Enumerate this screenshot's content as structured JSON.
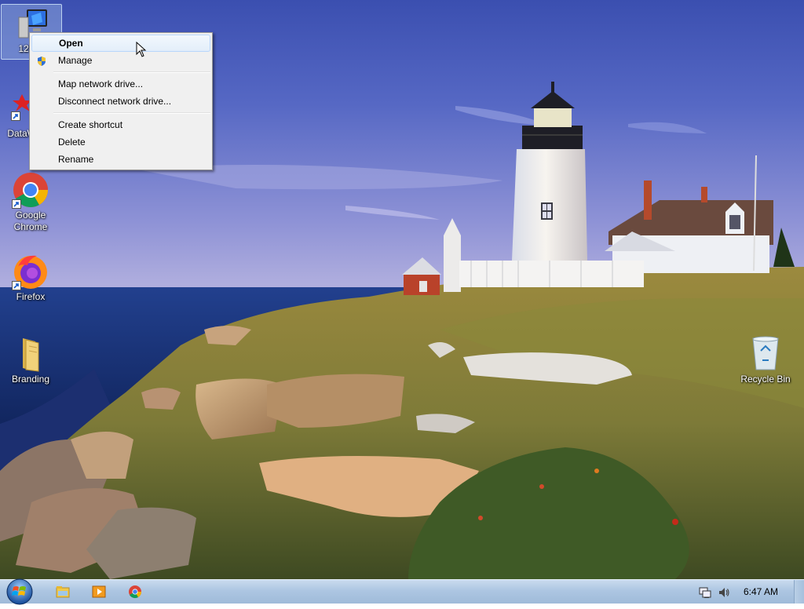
{
  "desktop": {
    "icons": [
      {
        "label": "12345"
      },
      {
        "label": "DataW"
      },
      {
        "label": "Google Chrome"
      },
      {
        "label": "Firefox"
      },
      {
        "label": "Branding"
      },
      {
        "label": "Recycle Bin"
      }
    ]
  },
  "context_menu": {
    "items": [
      {
        "label": "Open",
        "bold": true,
        "highlighted": true
      },
      {
        "label": "Manage",
        "icon": "uac-shield-icon"
      },
      {
        "label": "Map network drive..."
      },
      {
        "label": "Disconnect network drive..."
      },
      {
        "label": "Create shortcut"
      },
      {
        "label": "Delete"
      },
      {
        "label": "Rename"
      }
    ]
  },
  "taskbar": {
    "start_icon": "windows-orb-icon",
    "pinned": [
      {
        "name": "file-explorer-icon"
      },
      {
        "name": "media-player-icon"
      },
      {
        "name": "chrome-icon"
      }
    ],
    "tray": {
      "icons": [
        "network-icon",
        "volume-icon"
      ],
      "time": "6:47 AM"
    }
  },
  "colors": {
    "menu_bg": "#f0f0f0",
    "highlight_border": "#b8d6fb",
    "taskbar": "#adc6e2"
  }
}
